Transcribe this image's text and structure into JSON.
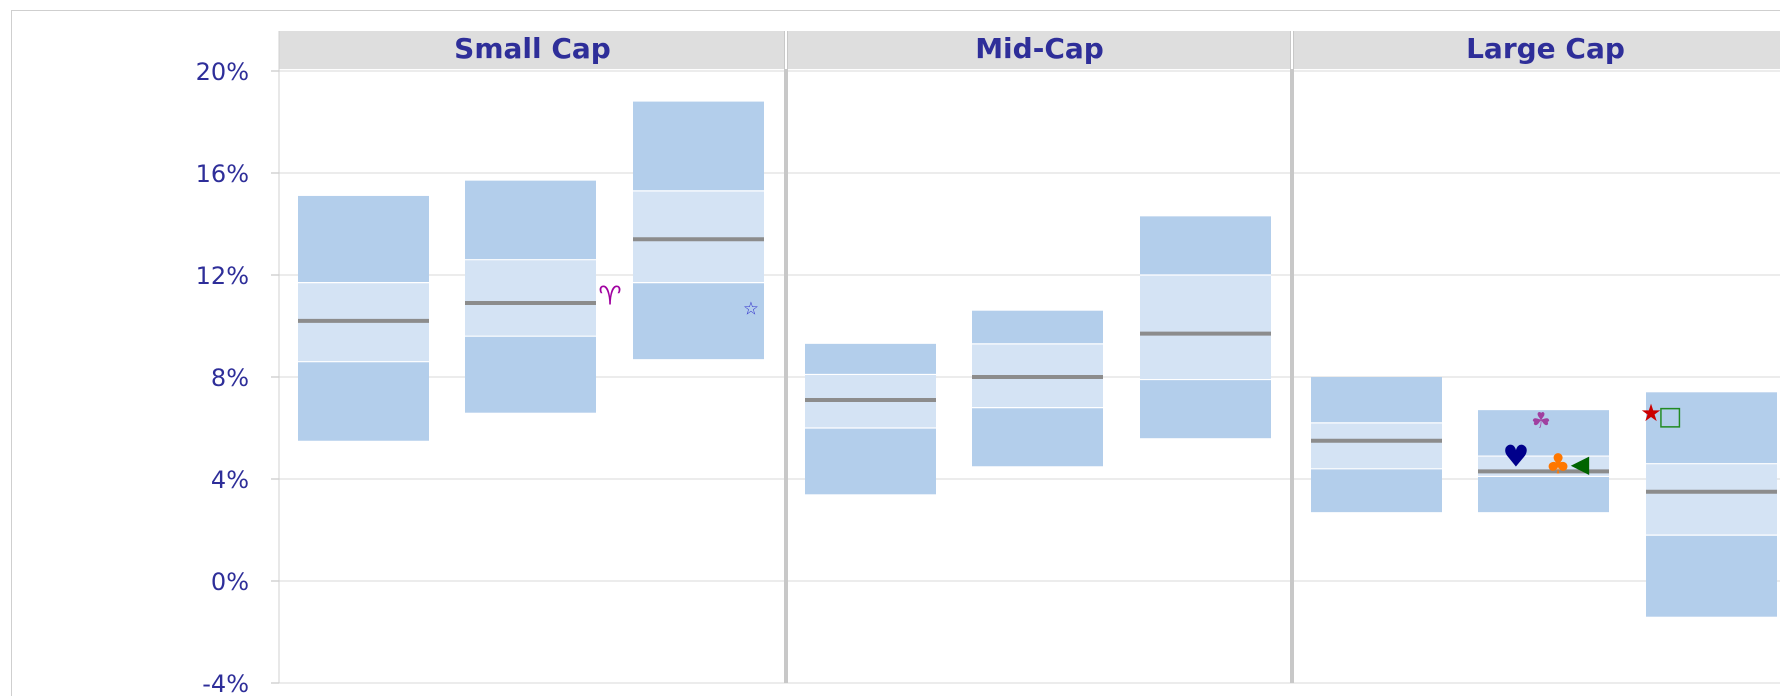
{
  "chart_data": {
    "type": "box",
    "y_unit": "%",
    "ylim": [
      -4,
      20
    ],
    "y_ticks": [
      20,
      16,
      12,
      8,
      4,
      0,
      -4
    ],
    "y_tick_labels": [
      "20%",
      "16%",
      "12%",
      "8%",
      "4%",
      "0%",
      "-4%"
    ],
    "grid": true,
    "panels": [
      {
        "title": "Small Cap",
        "boxes": [
          {
            "p5": 5.5,
            "p25": 8.6,
            "median": 10.2,
            "p75": 11.7,
            "p95": 15.1
          },
          {
            "p5": 6.6,
            "p25": 9.6,
            "median": 10.9,
            "p75": 12.6,
            "p95": 15.7
          },
          {
            "p5": 8.7,
            "p25": 11.7,
            "median": 13.4,
            "p75": 15.3,
            "p95": 18.8
          }
        ],
        "markers": [
          {
            "box": 1,
            "value": 11.2,
            "symbol": "♈",
            "color": "#a000a0"
          },
          {
            "box": 2,
            "value": 10.7,
            "symbol": "☆",
            "color": "#3333cc"
          }
        ]
      },
      {
        "title": "Mid-Cap",
        "boxes": [
          {
            "p5": 3.4,
            "p25": 6.0,
            "median": 7.1,
            "p75": 8.1,
            "p95": 9.3
          },
          {
            "p5": 4.5,
            "p25": 6.8,
            "median": 8.0,
            "p75": 9.3,
            "p95": 10.6
          },
          {
            "p5": 5.6,
            "p25": 7.9,
            "median": 9.7,
            "p75": 12.0,
            "p95": 14.3
          }
        ],
        "markers": []
      },
      {
        "title": "Large Cap",
        "boxes": [
          {
            "p5": 2.7,
            "p25": 4.4,
            "median": 5.5,
            "p75": 6.2,
            "p95": 8.0
          },
          {
            "p5": 2.7,
            "p25": 4.1,
            "median": 4.3,
            "p75": 4.9,
            "p95": 6.7
          },
          {
            "p5": -1.4,
            "p25": 1.8,
            "median": 3.5,
            "p75": 4.6,
            "p95": 7.4
          }
        ],
        "markers": [
          {
            "box": 1,
            "value": 6.3,
            "symbol": "☘",
            "color": "#a040a0"
          },
          {
            "box": 1,
            "value": 4.9,
            "symbol": "♥",
            "color": "#00008b"
          },
          {
            "box": 1,
            "value": 4.6,
            "symbol": "♣",
            "color": "#ff7700"
          },
          {
            "box": 1,
            "value": 4.6,
            "symbol": "◀",
            "color": "#006400"
          },
          {
            "box": 2,
            "value": 6.6,
            "symbol": "★",
            "color": "#cc0000"
          },
          {
            "box": 2,
            "value": 6.5,
            "symbol": "□",
            "color": "#228b22"
          }
        ]
      }
    ]
  },
  "colors": {
    "outer_band": "#b3ceeb",
    "inner_band": "#d4e3f4",
    "median_line": "#8c8c8c",
    "panel_header": "#dedede",
    "text": "#2e2e99",
    "grid": "#d9d9d9",
    "separator": "#c8c8c8"
  }
}
